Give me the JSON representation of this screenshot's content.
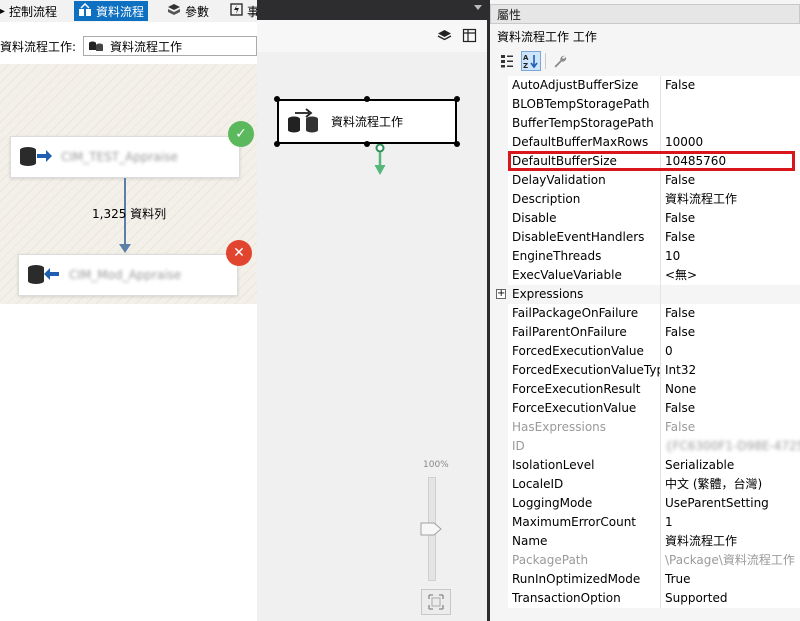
{
  "designer": {
    "tabs": [
      {
        "label": "控制流程",
        "icon": "control-flow-icon"
      },
      {
        "label": "資料流程",
        "icon": "data-flow-icon"
      },
      {
        "label": "參數",
        "icon": "parameters-icon"
      },
      {
        "label": "事",
        "icon": "event-handlers-icon"
      }
    ],
    "task_label": "資料流程工作:",
    "task_selected": "資料流程工作",
    "components": {
      "source": "CIM_TEST_Appraise",
      "destination": "CIM_Mod_Appraise"
    },
    "path_label": "1,325 資料列"
  },
  "control_flow": {
    "task_name": "資料流程工作",
    "zoom": "100%"
  },
  "properties": {
    "title": "屬性",
    "object": "資料流程工作  工作",
    "rows": [
      {
        "key": "AutoAdjustBufferSize",
        "value": "False"
      },
      {
        "key": "BLOBTempStoragePath",
        "value": ""
      },
      {
        "key": "BufferTempStoragePath",
        "value": ""
      },
      {
        "key": "DefaultBufferMaxRows",
        "value": "10000"
      },
      {
        "key": "DefaultBufferSize",
        "value": "10485760"
      },
      {
        "key": "DelayValidation",
        "value": "False"
      },
      {
        "key": "Description",
        "value": "資料流程工作"
      },
      {
        "key": "Disable",
        "value": "False"
      },
      {
        "key": "DisableEventHandlers",
        "value": "False"
      },
      {
        "key": "EngineThreads",
        "value": "10"
      },
      {
        "key": "ExecValueVariable",
        "value": "<無>"
      },
      {
        "key": "Expressions",
        "value": ""
      },
      {
        "key": "FailPackageOnFailure",
        "value": "False"
      },
      {
        "key": "FailParentOnFailure",
        "value": "False"
      },
      {
        "key": "ForcedExecutionValue",
        "value": "0"
      },
      {
        "key": "ForcedExecutionValueTyp",
        "value": "Int32"
      },
      {
        "key": "ForceExecutionResult",
        "value": "None"
      },
      {
        "key": "ForceExecutionValue",
        "value": "False"
      },
      {
        "key": "HasExpressions",
        "value": "False"
      },
      {
        "key": "ID",
        "value": "{FC6300F1-D98E-4725-"
      },
      {
        "key": "IsolationLevel",
        "value": "Serializable"
      },
      {
        "key": "LocaleID",
        "value": "中文 (繁體，台灣)"
      },
      {
        "key": "LoggingMode",
        "value": "UseParentSetting"
      },
      {
        "key": "MaximumErrorCount",
        "value": "1"
      },
      {
        "key": "Name",
        "value": "資料流程工作"
      },
      {
        "key": "PackagePath",
        "value": "\\Package\\資料流程工作"
      },
      {
        "key": "RunInOptimizedMode",
        "value": "True"
      },
      {
        "key": "TransactionOption",
        "value": "Supported"
      }
    ]
  },
  "colors": {
    "accent": "#0e70c0",
    "highlight": "#d9161c",
    "success": "#5cb85c",
    "error": "#e2452f",
    "path": "#5b7fa8"
  }
}
